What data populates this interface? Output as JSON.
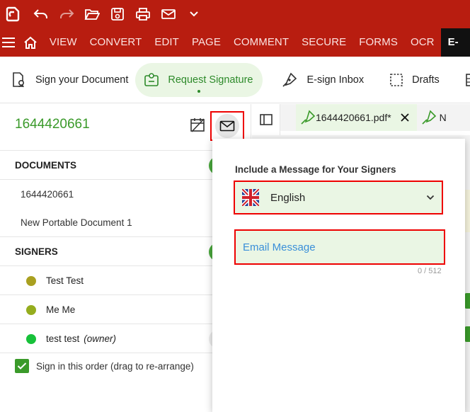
{
  "quick_access": {
    "icons": [
      "app-logo-icon",
      "undo-icon",
      "redo-icon",
      "open-folder-icon",
      "save-icon",
      "print-icon",
      "email-icon",
      "chevron-down-icon"
    ]
  },
  "menu": {
    "items": [
      "VIEW",
      "CONVERT",
      "EDIT",
      "PAGE",
      "COMMENT",
      "SECURE",
      "FORMS",
      "OCR"
    ],
    "active": "E-SI"
  },
  "toolbar": {
    "sign_your_document": "Sign your Document",
    "request_signature": "Request Signature",
    "esign_inbox": "E-sign Inbox",
    "drafts": "Drafts"
  },
  "left_panel": {
    "document_id": "1644420661",
    "documents_title": "DOCUMENTS",
    "documents": [
      "1644420661",
      "New Portable Document 1"
    ],
    "signers_title": "SIGNERS",
    "signers": [
      {
        "name": "Test Test",
        "color": "#a9a020",
        "owner": ""
      },
      {
        "name": "Me Me",
        "color": "#95ad1e",
        "owner": ""
      },
      {
        "name": "test test",
        "color": "#17c13a",
        "owner": "(owner)"
      }
    ],
    "sign_in_order": "Sign in this order (drag to re-arrange)"
  },
  "tabs": {
    "active_tab": "1644420661.pdf*",
    "next_tab": "N"
  },
  "popover": {
    "title": "Include a Message for Your Signers",
    "language": "English",
    "message_placeholder": "Email Message",
    "counter": "0 / 512"
  },
  "colors": {
    "brand_red": "#b81d10",
    "accent_green": "#3a9a2a",
    "light_green": "#eaf6e4",
    "highlight_red": "#ee0000"
  }
}
